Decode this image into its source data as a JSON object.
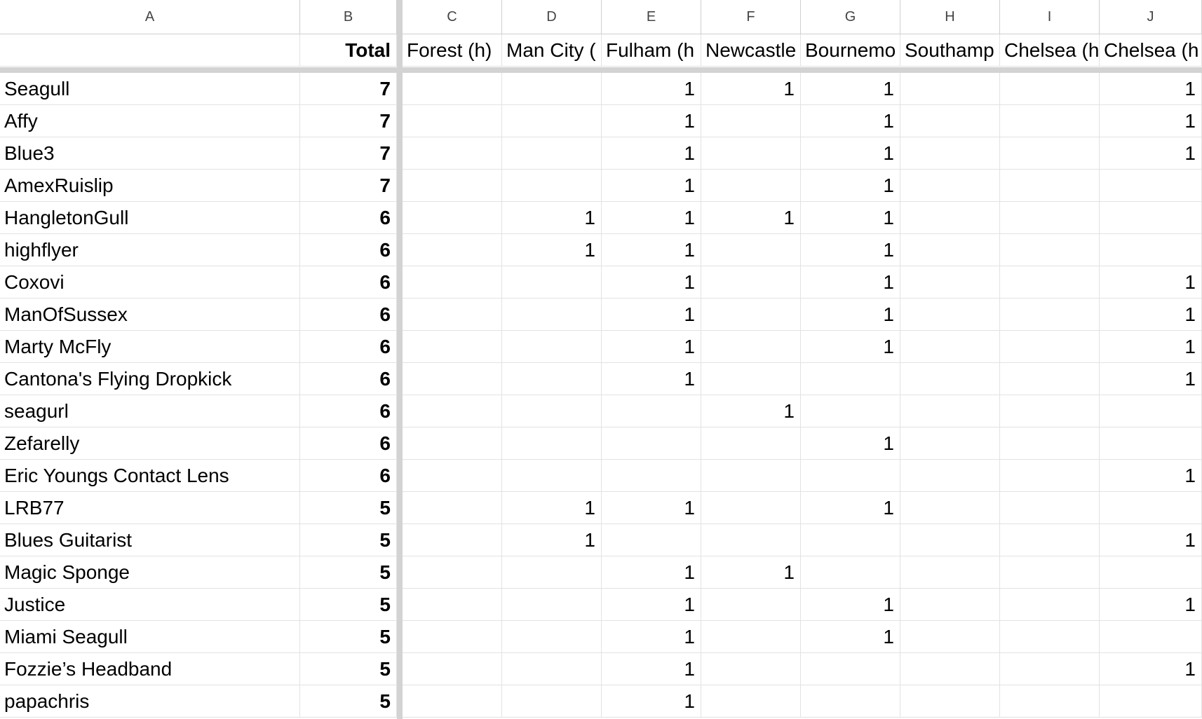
{
  "columns": [
    "A",
    "B",
    "C",
    "D",
    "E",
    "F",
    "G",
    "H",
    "I",
    "J"
  ],
  "header_labels": [
    "",
    "Total",
    "Forest (h)",
    "Man City (",
    "Fulham (h",
    "Newcastle",
    "Bournemo",
    "Southamp",
    "Chelsea (h",
    "Chelsea (h"
  ],
  "rows": [
    {
      "name": "Seagull",
      "total": "7",
      "cells": [
        "",
        "",
        "1",
        "1",
        "1",
        "",
        "",
        "1"
      ]
    },
    {
      "name": "Affy",
      "total": "7",
      "cells": [
        "",
        "",
        "1",
        "",
        "1",
        "",
        "",
        "1"
      ]
    },
    {
      "name": "Blue3",
      "total": "7",
      "cells": [
        "",
        "",
        "1",
        "",
        "1",
        "",
        "",
        "1"
      ]
    },
    {
      "name": "AmexRuislip",
      "total": "7",
      "cells": [
        "",
        "",
        "1",
        "",
        "1",
        "",
        "",
        ""
      ]
    },
    {
      "name": "HangletonGull",
      "total": "6",
      "cells": [
        "",
        "1",
        "1",
        "1",
        "1",
        "",
        "",
        ""
      ]
    },
    {
      "name": "highflyer",
      "total": "6",
      "cells": [
        "",
        "1",
        "1",
        "",
        "1",
        "",
        "",
        ""
      ]
    },
    {
      "name": "Coxovi",
      "total": "6",
      "cells": [
        "",
        "",
        "1",
        "",
        "1",
        "",
        "",
        "1"
      ]
    },
    {
      "name": "ManOfSussex",
      "total": "6",
      "cells": [
        "",
        "",
        "1",
        "",
        "1",
        "",
        "",
        "1"
      ]
    },
    {
      "name": "Marty McFly",
      "total": "6",
      "cells": [
        "",
        "",
        "1",
        "",
        "1",
        "",
        "",
        "1"
      ]
    },
    {
      "name": "Cantona's Flying Dropkick",
      "total": "6",
      "cells": [
        "",
        "",
        "1",
        "",
        "",
        "",
        "",
        "1"
      ]
    },
    {
      "name": "seagurl",
      "total": "6",
      "cells": [
        "",
        "",
        "",
        "1",
        "",
        "",
        "",
        ""
      ]
    },
    {
      "name": "Zefarelly",
      "total": "6",
      "cells": [
        "",
        "",
        "",
        "",
        "1",
        "",
        "",
        ""
      ]
    },
    {
      "name": "Eric Youngs Contact Lens",
      "total": "6",
      "cells": [
        "",
        "",
        "",
        "",
        "",
        "",
        "",
        "1"
      ]
    },
    {
      "name": "LRB77",
      "total": "5",
      "cells": [
        "",
        "1",
        "1",
        "",
        "1",
        "",
        "",
        ""
      ]
    },
    {
      "name": "Blues Guitarist",
      "total": "5",
      "cells": [
        "",
        "1",
        "",
        "",
        "",
        "",
        "",
        "1"
      ]
    },
    {
      "name": "Magic Sponge",
      "total": "5",
      "cells": [
        "",
        "",
        "1",
        "1",
        "",
        "",
        "",
        ""
      ]
    },
    {
      "name": "Justice",
      "total": "5",
      "cells": [
        "",
        "",
        "1",
        "",
        "1",
        "",
        "",
        "1"
      ]
    },
    {
      "name": "Miami Seagull",
      "total": "5",
      "cells": [
        "",
        "",
        "1",
        "",
        "1",
        "",
        "",
        ""
      ]
    },
    {
      "name": "Fozzie’s Headband",
      "total": "5",
      "cells": [
        "",
        "",
        "1",
        "",
        "",
        "",
        "",
        "1"
      ]
    },
    {
      "name": "papachris",
      "total": "5",
      "cells": [
        "",
        "",
        "1",
        "",
        "",
        "",
        "",
        ""
      ]
    }
  ]
}
